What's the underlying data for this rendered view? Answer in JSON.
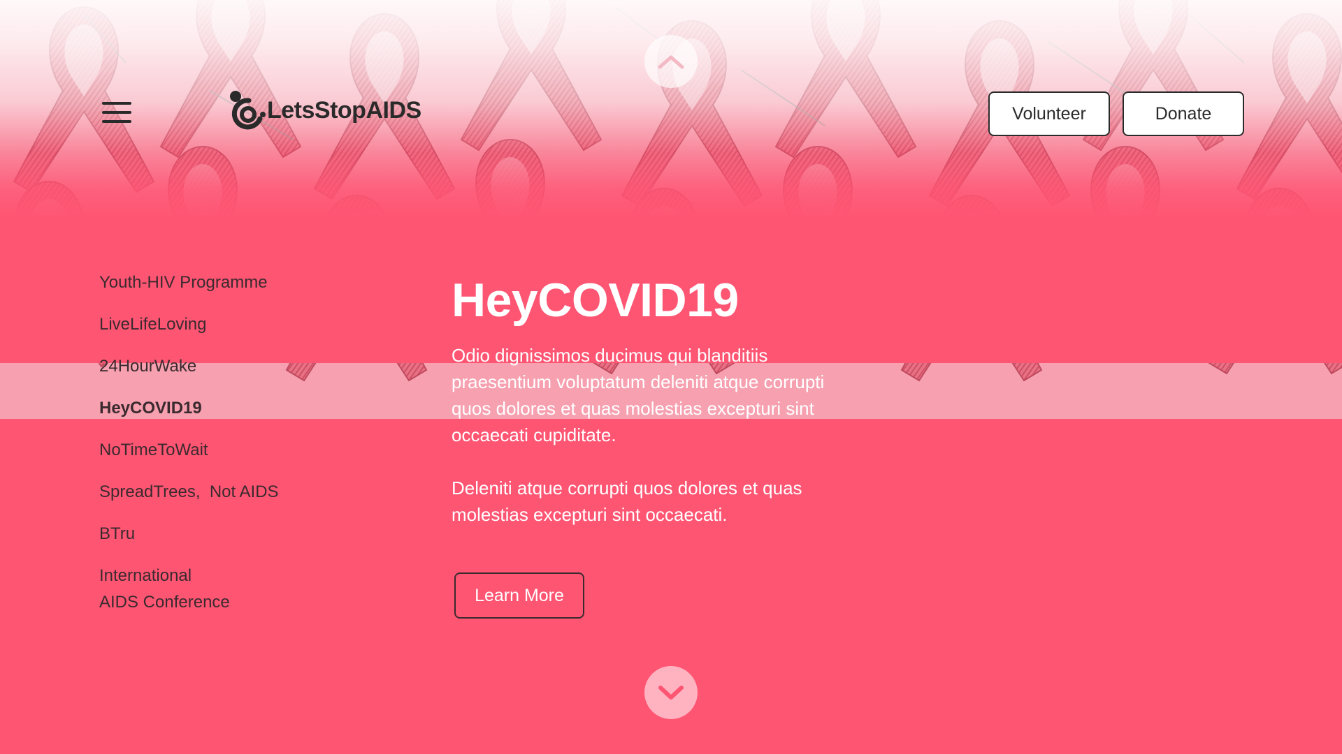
{
  "brand": {
    "name": "LetsStopAIDS"
  },
  "header": {
    "menu_icon": "hamburger-menu-icon",
    "volunteer_label": "Volunteer",
    "donate_label": "Donate"
  },
  "sidebar": {
    "items": [
      {
        "label": "Youth-HIV Programme",
        "active": false
      },
      {
        "label": "LiveLifeLoving",
        "active": false
      },
      {
        "label": "24HourWake",
        "active": false
      },
      {
        "label": "HeyCOVID19",
        "active": true
      },
      {
        "label": "NoTimeToWait",
        "active": false
      },
      {
        "label": "SpreadTrees,  Not AIDS",
        "active": false
      },
      {
        "label": "BTru",
        "active": false
      },
      {
        "label_line1": "International",
        "label_line2": "AIDS Conference",
        "active": false
      }
    ]
  },
  "main": {
    "title": "HeyCOVID19",
    "paragraph1": "Odio dignissimos ducimus qui blanditiis praesentium voluptatum deleniti atque corrupti quos dolores et quas molestias excepturi sint occaecati cupiditate.",
    "paragraph2": "Deleniti atque corrupti quos dolores et quas molestias excepturi sint occaecati.",
    "cta_label": "Learn More"
  },
  "controls": {
    "scroll_up_icon": "chevron-up-icon",
    "scroll_down_icon": "chevron-down-icon"
  },
  "colors": {
    "background": "#fe5573",
    "text_dark": "#2a2a2a",
    "text_light": "#ffffff",
    "scroll_down_bg": "#ffb3c1"
  }
}
